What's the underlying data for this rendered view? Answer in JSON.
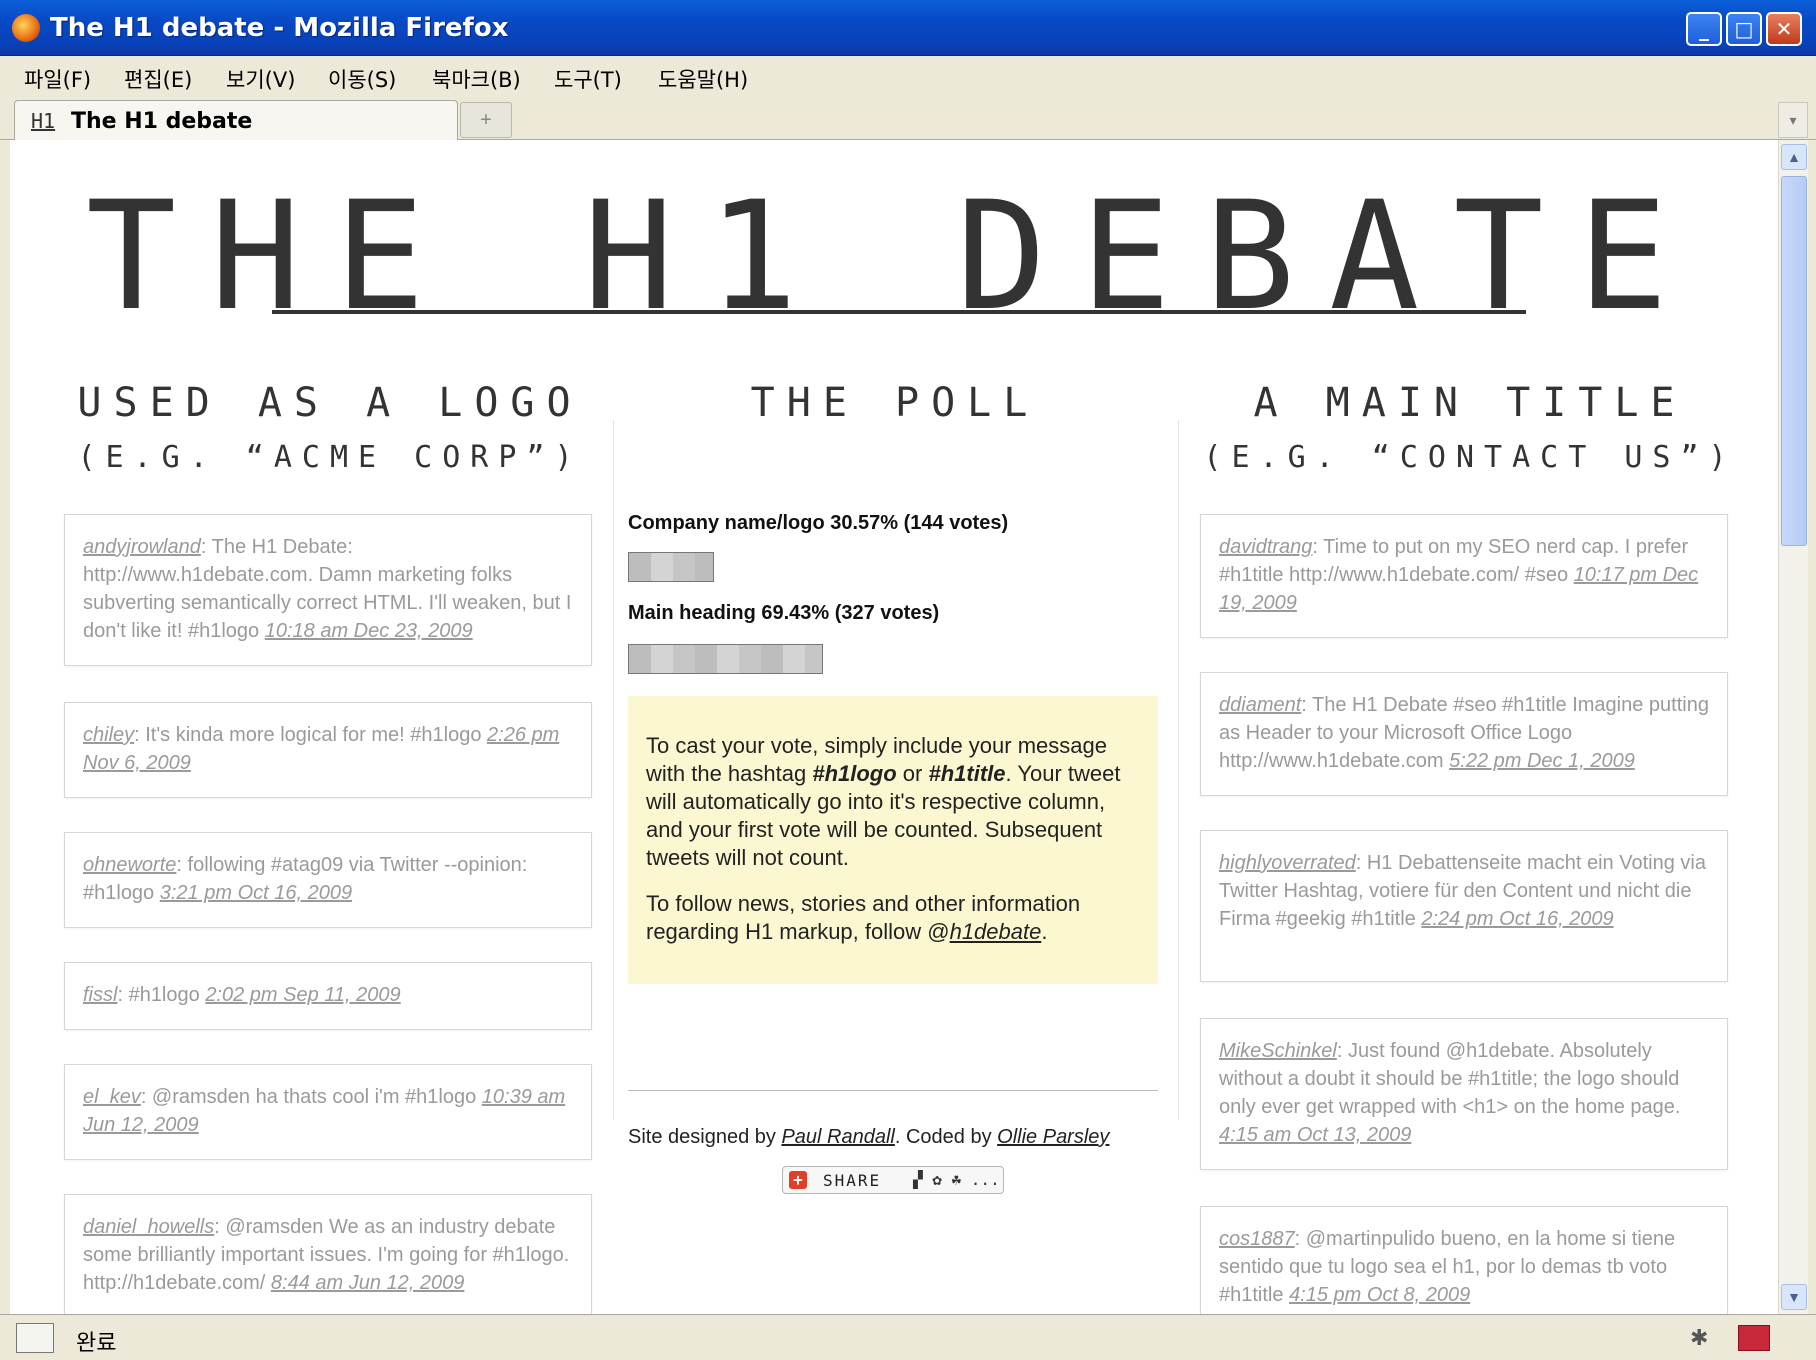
{
  "window": {
    "title": "The H1 debate - Mozilla Firefox",
    "minimize": "_",
    "maximize": "□",
    "close": "✕"
  },
  "menu": [
    "파일(F)",
    "편집(E)",
    "보기(V)",
    "이동(S)",
    "북마크(B)",
    "도구(T)",
    "도움말(H)"
  ],
  "tab": {
    "favicon": "H1",
    "title": "The H1 debate",
    "new_tab": "+"
  },
  "page": {
    "site_title": "THE H1 DEBATE",
    "left": {
      "heading": "USED AS A LOGO",
      "subheading": "(E.G. “ACME CORP”)",
      "tweets": [
        {
          "user": "andyjrowland",
          "text": ": The H1 Debate: http://www.h1debate.com. Damn marketing folks subverting semantically correct HTML. I'll weaken, but I don't like it! #h1logo ",
          "time": "10:18 am Dec 23, 2009"
        },
        {
          "user": "chiley",
          "text": ": It's kinda more logical for me! #h1logo ",
          "time": "2:26 pm Nov 6, 2009"
        },
        {
          "user": "ohneworte",
          "text": ": following #atag09 via Twitter --opinion: #h1logo ",
          "time": "3:21 pm Oct 16, 2009"
        },
        {
          "user": "fissl",
          "text": ": #h1logo ",
          "time": "2:02 pm Sep 11, 2009"
        },
        {
          "user": "el_kev",
          "text": ": @ramsden ha thats cool i'm #h1logo ",
          "time": "10:39 am Jun 12, 2009"
        },
        {
          "user": "daniel_howells",
          "text": ": @ramsden We as an industry debate some brilliantly important issues. I'm going for #h1logo. http://h1debate.com/ ",
          "time": "8:44 am Jun 12, 2009"
        }
      ]
    },
    "center": {
      "heading": "THE POLL",
      "poll": [
        {
          "label": "Company name/logo 30.57% (144 votes)",
          "percent": 30.57
        },
        {
          "label": "Main heading 69.43% (327 votes)",
          "percent": 69.43
        }
      ],
      "info": {
        "p1_a": "To cast your vote, simply include your message with the hashtag ",
        "hash1": "#h1logo",
        "p1_b": " or ",
        "hash2": "#h1title",
        "p1_c": ". Your tweet will automatically go into it's respective column, and your first vote will be counted. Subsequent tweets will not count.",
        "p2_a": "To follow news, stories and other information regarding H1 markup, follow @",
        "p2_link": "h1debate",
        "p2_b": "."
      },
      "credits": {
        "a": "Site designed by ",
        "designer": "Paul Randall",
        "b": ". Coded by ",
        "coder": "Ollie Parsley"
      },
      "share": {
        "label": "SHARE",
        "icons": "▞ ✿ ☘ ..."
      }
    },
    "right": {
      "heading": "A MAIN TITLE",
      "subheading": "(E.G. “CONTACT US”)",
      "tweets": [
        {
          "user": "davidtrang",
          "text": ": Time to put on my SEO nerd cap. I prefer #h1title http://www.h1debate.com/ #seo ",
          "time": "10:17 pm Dec 19, 2009"
        },
        {
          "user": "ddiament",
          "text": ": The H1 Debate #seo #h1title Imagine putting as Header to your Microsoft Office Logo http://www.h1debate.com ",
          "time": "5:22 pm Dec 1, 2009"
        },
        {
          "user": "highlyoverrated",
          "text": ": H1 Debattenseite macht ein Voting via Twitter Hashtag, votiere für den Content und nicht die Firma #geekig #h1title ",
          "time": "2:24 pm Oct 16, 2009"
        },
        {
          "user": "MikeSchinkel",
          "text": ": Just found @h1debate. Absolutely without a doubt it should be #h1title; the logo should only ever get wrapped with <h1> on the home page. ",
          "time": "4:15 am Oct 13, 2009"
        },
        {
          "user": "cos1887",
          "text": ": @martinpulido bueno, en la home si tiene sentido que tu logo sea el h1, por lo demas tb voto #h1title ",
          "time": "4:15 pm Oct 8, 2009"
        }
      ]
    }
  },
  "status": {
    "text": "완료"
  },
  "icons": {
    "browser": "firefox-icon",
    "status": "connection-icon",
    "bug": "bug-icon",
    "addon": "addon-icon"
  }
}
